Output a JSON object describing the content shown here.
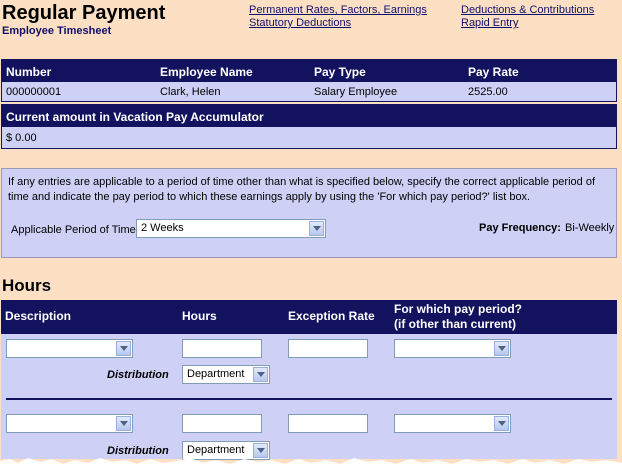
{
  "header": {
    "title": "Regular Payment",
    "subtitle": "Employee Timesheet",
    "links": {
      "permanent_rates": "Permanent Rates, Factors, Earnings",
      "statutory_deductions": "Statutory Deductions",
      "deductions_contributions": "Deductions & Contributions",
      "rapid_entry": "Rapid Entry"
    }
  },
  "employee": {
    "columns": {
      "number": "Number",
      "name": "Employee Name",
      "pay_type": "Pay Type",
      "pay_rate": "Pay Rate"
    },
    "row": {
      "number": "000000001",
      "name": "Clark, Helen",
      "pay_type": "Salary Employee",
      "pay_rate": "2525.00"
    }
  },
  "vacation": {
    "heading": "Current amount in Vacation Pay Accumulator",
    "amount": "$ 0.00"
  },
  "period": {
    "instructions": "If any entries are applicable to a period of time other than what is specified below, specify the correct applicable period of time and indicate the pay period to which these earnings apply by using the 'For which pay period?' list box.",
    "applicable_label": "Applicable Period of Time",
    "applicable_value": "2 Weeks",
    "frequency_label": "Pay Frequency:",
    "frequency_value": "Bi-Weekly"
  },
  "hours": {
    "heading": "Hours",
    "columns": {
      "description": "Description",
      "hours": "Hours",
      "exception_rate": "Exception Rate",
      "pay_period_line1": "For which pay period?",
      "pay_period_line2": "(if other than current)"
    },
    "distribution_label": "Distribution",
    "rows": [
      {
        "distribution_value": "Department"
      },
      {
        "distribution_value": "Department"
      }
    ]
  },
  "colors": {
    "navy": "#13125e",
    "lavender": "#cfd0f6",
    "peach": "#fde0c4"
  }
}
